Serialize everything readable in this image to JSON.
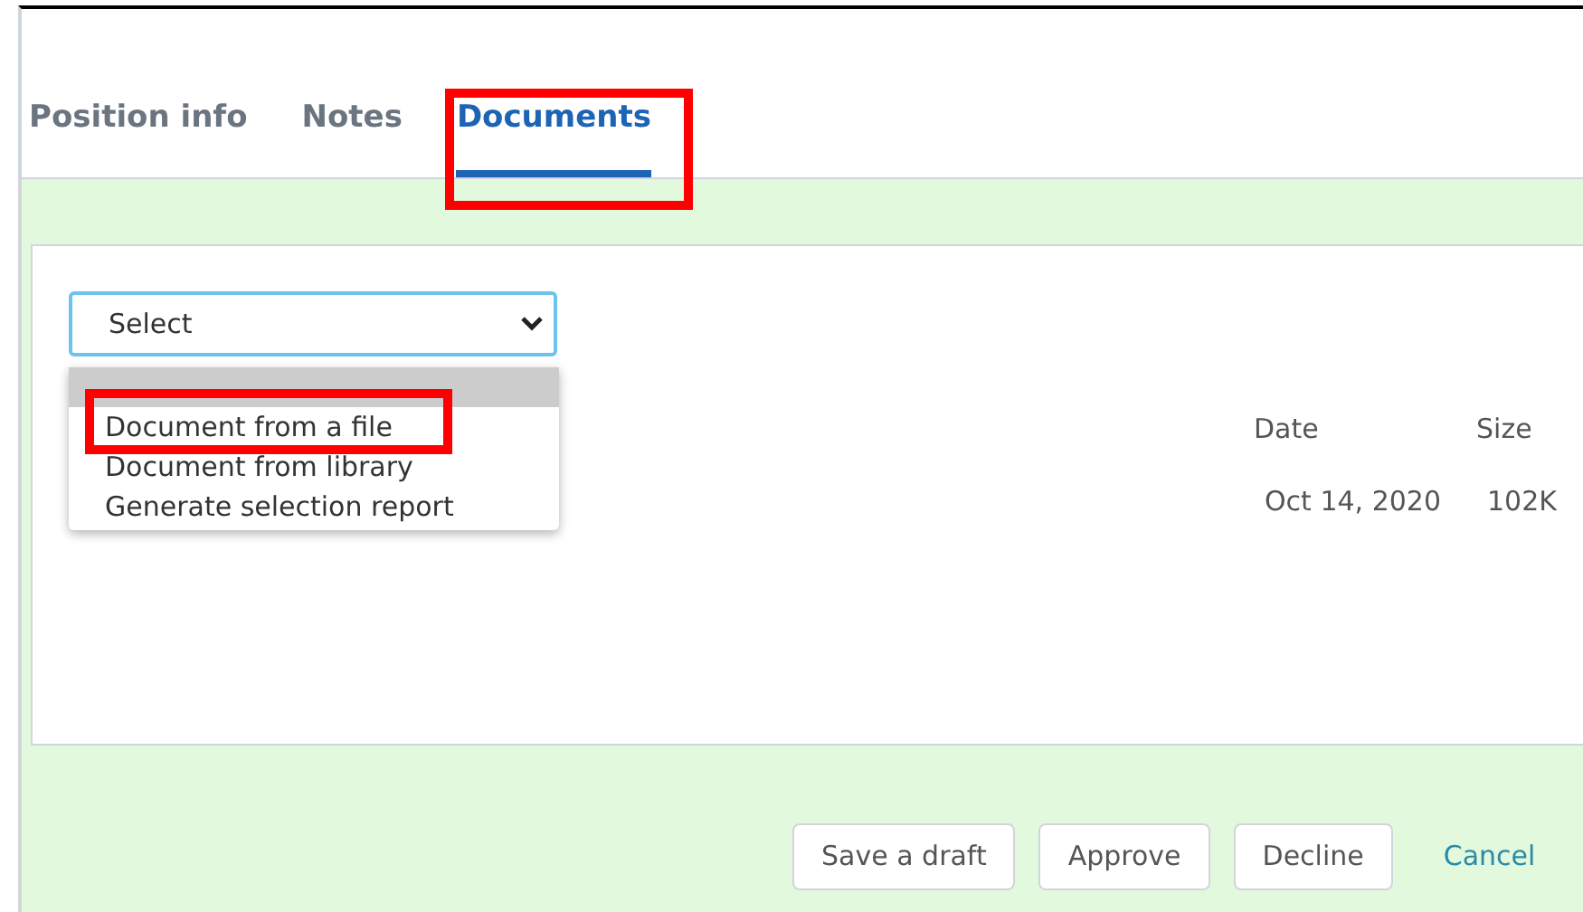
{
  "tabs": [
    {
      "label": "Position info",
      "selected": false,
      "highlighted": false
    },
    {
      "label": "Notes",
      "selected": false,
      "highlighted": false
    },
    {
      "label": "Documents",
      "selected": true,
      "highlighted": true
    }
  ],
  "document_select": {
    "value": "Select",
    "expanded": true,
    "options": [
      {
        "selected": true,
        "highlighted": false
      },
      {
        "label": "Document from a file",
        "selected": false,
        "highlighted": true
      },
      {
        "label": "Document from library",
        "selected": false,
        "highlighted": false
      },
      {
        "label": "Generate selection report",
        "selected": false,
        "highlighted": false
      }
    ]
  },
  "table": {
    "columns": [
      "Date",
      "Size"
    ],
    "rows": [
      [
        "Oct 14, 2020",
        "102K"
      ]
    ]
  },
  "buttons": [
    {
      "label": "Save a draft",
      "kind": "button"
    },
    {
      "label": "Approve",
      "kind": "button"
    },
    {
      "label": "Decline",
      "kind": "button"
    },
    {
      "label": "Cancel",
      "kind": "link"
    }
  ]
}
